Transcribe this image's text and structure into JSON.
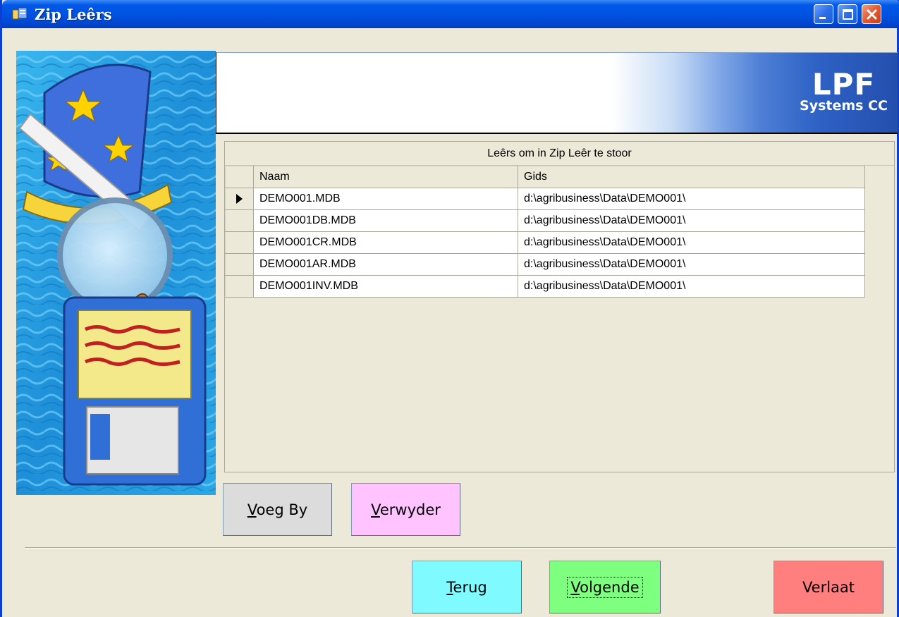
{
  "window": {
    "title": "Zip Leêrs"
  },
  "banner": {
    "logo_line1": "LPF",
    "logo_line2": "Systems CC"
  },
  "grid": {
    "caption": "Leêrs om in Zip Leêr te stoor",
    "columns": [
      "Naam",
      "Gids"
    ],
    "rows": [
      {
        "name": "DEMO001.MDB",
        "dir": "d:\\agribusiness\\Data\\DEMO001\\",
        "current": true
      },
      {
        "name": "DEMO001DB.MDB",
        "dir": "d:\\agribusiness\\Data\\DEMO001\\",
        "current": false
      },
      {
        "name": "DEMO001CR.MDB",
        "dir": "d:\\agribusiness\\Data\\DEMO001\\",
        "current": false
      },
      {
        "name": "DEMO001AR.MDB",
        "dir": "d:\\agribusiness\\Data\\DEMO001\\",
        "current": false
      },
      {
        "name": "DEMO001INV.MDB",
        "dir": "d:\\agribusiness\\Data\\DEMO001\\",
        "current": false
      }
    ]
  },
  "buttons": {
    "add": {
      "mnemonic": "V",
      "rest": "oeg By"
    },
    "remove": {
      "mnemonic": "V",
      "rest": "erwyder"
    },
    "back": {
      "mnemonic": "T",
      "rest": "erug"
    },
    "next": {
      "mnemonic": "V",
      "rest": "olgende"
    },
    "exit": {
      "label": "Verlaat"
    }
  },
  "colors": {
    "titlebar": "#0054e3",
    "add_button": "#dcdcdc",
    "remove_button": "#ffc3ff",
    "back_button": "#7ffaff",
    "next_button": "#7fff7f",
    "exit_button": "#ff7f7f",
    "window_bg": "#ece9d8"
  },
  "icons": [
    "app-icon",
    "minimize-icon",
    "maximize-icon",
    "close-icon",
    "row-pointer-icon",
    "wizard-illustration"
  ]
}
